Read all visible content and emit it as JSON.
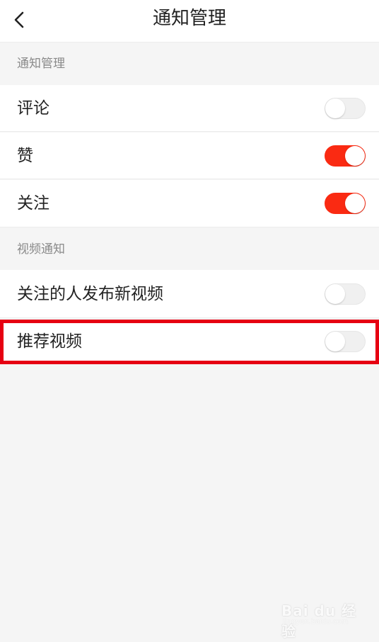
{
  "header": {
    "title": "通知管理",
    "back_icon": "chevron-left-icon"
  },
  "sections": [
    {
      "title": "通知管理",
      "items": [
        {
          "label": "评论",
          "enabled": false
        },
        {
          "label": "赞",
          "enabled": true
        },
        {
          "label": "关注",
          "enabled": true
        }
      ]
    },
    {
      "title": "视频通知",
      "items": [
        {
          "label": "关注的人发布新视频",
          "enabled": false
        },
        {
          "label": "推荐视频",
          "enabled": false
        }
      ]
    }
  ],
  "colors": {
    "accent": "#fa2a12",
    "highlight": "#e60012",
    "background": "#f5f5f5"
  },
  "watermark": {
    "brand": "Bai du 经验",
    "url": "jingyan.baidu.com"
  }
}
